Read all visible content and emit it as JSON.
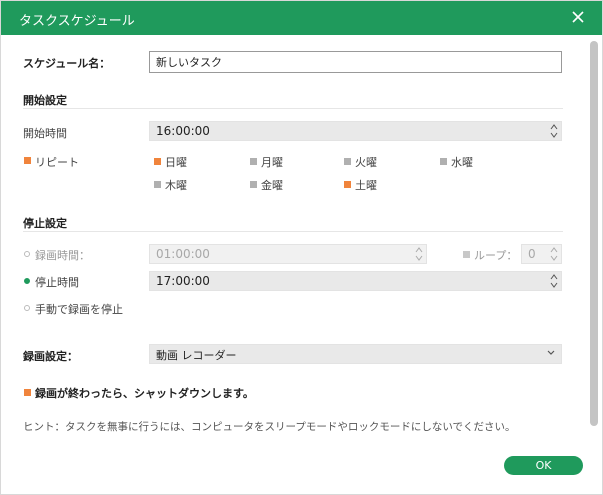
{
  "window": {
    "title": "タスクスケジュール"
  },
  "schedule_name": {
    "label": "スケジュール名：",
    "value": "新しいタスク"
  },
  "start_settings": {
    "heading": "開始設定",
    "start_time_label": "開始時間",
    "start_time_value": "16:00:00",
    "repeat": {
      "label": "リピート",
      "checked": true,
      "days": [
        {
          "label": "日曜",
          "checked": true
        },
        {
          "label": "月曜",
          "checked": false
        },
        {
          "label": "火曜",
          "checked": false
        },
        {
          "label": "水曜",
          "checked": false
        },
        {
          "label": "木曜",
          "checked": false
        },
        {
          "label": "金曜",
          "checked": false
        },
        {
          "label": "土曜",
          "checked": true
        }
      ]
    }
  },
  "stop_settings": {
    "heading": "停止設定",
    "duration_label": "録画時間：",
    "duration_value": "01:00:00",
    "loop_label": "ループ：",
    "loop_value": "0",
    "stop_time_label": "停止時間",
    "stop_time_value": "17:00:00",
    "manual_label": "手動で録画を停止",
    "selected": "stop_time"
  },
  "recording_settings": {
    "label": "録画設定：",
    "value": "動画 レコーダー"
  },
  "shutdown": {
    "label": "録画が終わったら、シャットダウンします。",
    "checked": true
  },
  "hint": "ヒント：タスクを無事に行うには、コンピュータをスリープモードやロックモードにしないでください。",
  "buttons": {
    "ok": "OK"
  },
  "colors": {
    "accent": "#1f9a5c",
    "checkbox_on": "#f0843c"
  }
}
